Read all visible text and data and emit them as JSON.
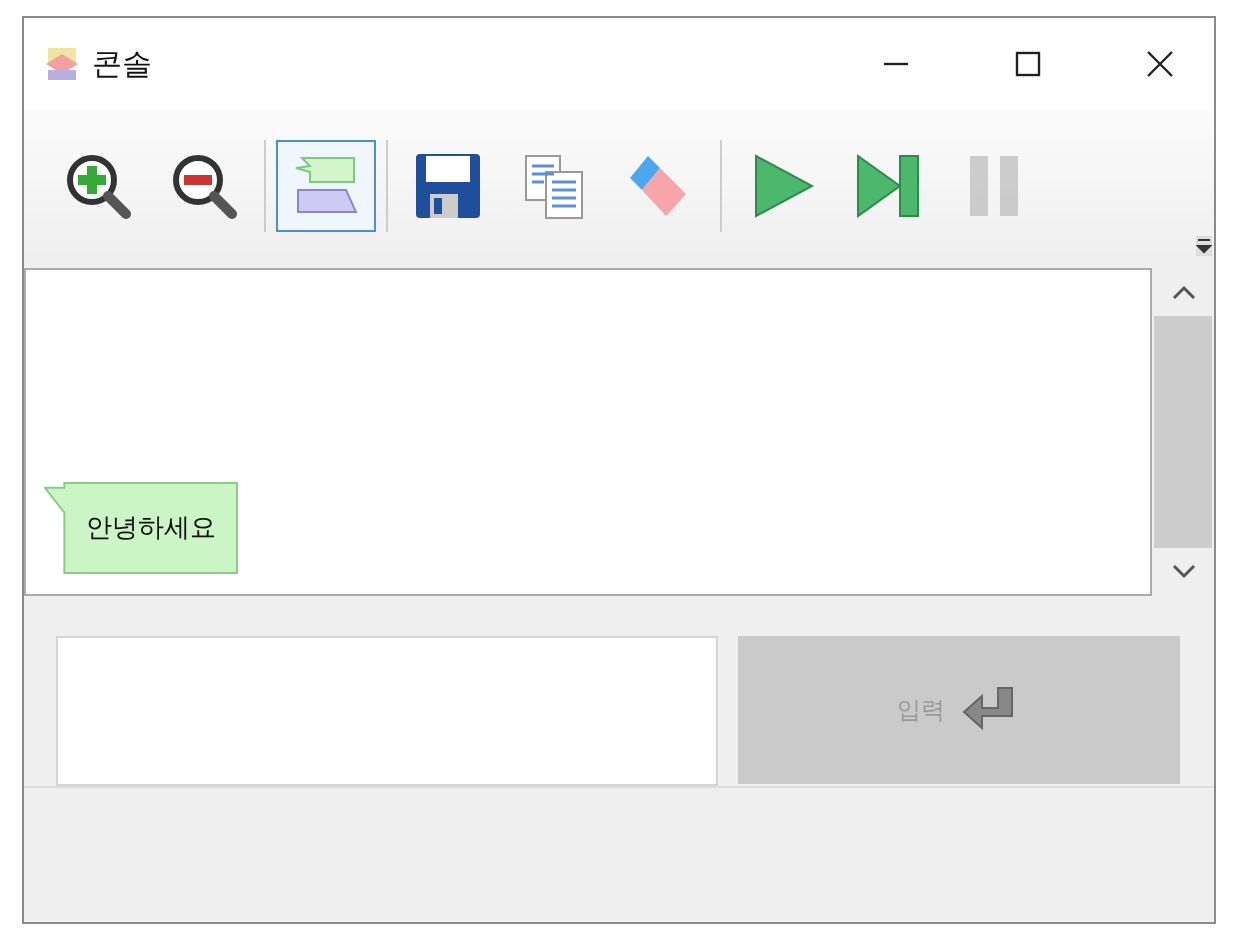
{
  "window": {
    "title": "콘솔"
  },
  "toolbar": {
    "groups": [
      [
        {
          "kind": "zoom-in",
          "pressed": false,
          "disabled": false
        },
        {
          "kind": "zoom-out",
          "pressed": false,
          "disabled": false
        }
      ],
      [
        {
          "kind": "bubbles",
          "pressed": true,
          "disabled": false
        }
      ],
      [
        {
          "kind": "save",
          "pressed": false,
          "disabled": false
        },
        {
          "kind": "copy",
          "pressed": false,
          "disabled": false
        },
        {
          "kind": "eraser",
          "pressed": false,
          "disabled": false
        }
      ],
      [
        {
          "kind": "play",
          "pressed": false,
          "disabled": false
        },
        {
          "kind": "step",
          "pressed": false,
          "disabled": false
        },
        {
          "kind": "pause",
          "pressed": false,
          "disabled": true
        }
      ]
    ]
  },
  "messages": [
    {
      "text": "안녕하세요"
    }
  ],
  "send_button": {
    "label": "입력",
    "disabled": true
  }
}
